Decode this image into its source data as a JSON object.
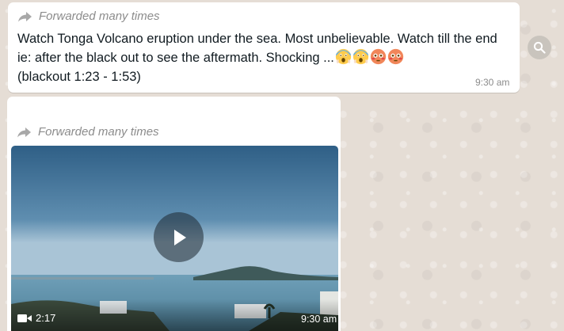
{
  "message1": {
    "forwarded_label": "Forwarded many times",
    "text": "Watch Tonga Volcano eruption under the sea. Most unbelievable. Watch till the end ie: after the black out to see the aftermath. Shocking ...",
    "text_line2": "(blackout 1:23 - 1:53)",
    "emojis": [
      "face-screaming-in-fear",
      "face-screaming-in-fear",
      "flushed-face",
      "flushed-face"
    ],
    "time": "9:30 am"
  },
  "message2": {
    "forwarded_label": "Forwarded many times",
    "video": {
      "duration": "2:17",
      "time": "9:30 am",
      "play_icon": "play-icon",
      "camera_icon": "video-camera-icon"
    }
  },
  "colors": {
    "bubble": "#ffffff",
    "wallpaper": "#e5ddd5",
    "meta_text": "#8c8c8c"
  },
  "icons": {
    "forward": "forward-arrow-icon",
    "search": "search-icon"
  }
}
